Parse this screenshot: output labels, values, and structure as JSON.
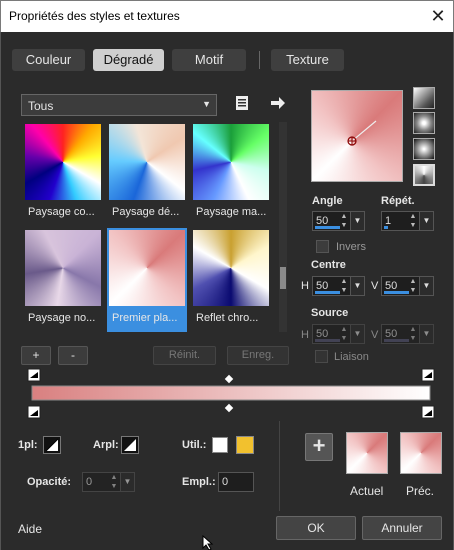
{
  "window": {
    "title": "Propriétés des styles et textures",
    "close": "✕"
  },
  "tabs": [
    {
      "label": "Couleur",
      "selected": false
    },
    {
      "label": "Dégradé",
      "selected": true
    },
    {
      "label": "Motif",
      "selected": false
    },
    {
      "label": "Texture",
      "selected": false
    }
  ],
  "filter": {
    "selected": "Tous"
  },
  "thumbnails": [
    {
      "label": "Paysage co..."
    },
    {
      "label": "Paysage dé..."
    },
    {
      "label": "Paysage ma..."
    },
    {
      "label": "Paysage no..."
    },
    {
      "label": "Premier pla..."
    },
    {
      "label": "Reflet chro..."
    }
  ],
  "list_buttons": {
    "add": "+",
    "remove": "-",
    "reset": "Réinit.",
    "save": "Enreg."
  },
  "angle": {
    "label": "Angle",
    "value": "50"
  },
  "repeat": {
    "label": "Répét.",
    "value": "1"
  },
  "invert": {
    "label": "Invers"
  },
  "center": {
    "label": "Centre",
    "h_label": "H",
    "h": "50",
    "v_label": "V",
    "v": "50"
  },
  "source": {
    "label": "Source",
    "h_label": "H",
    "h": "50",
    "v_label": "V",
    "v": "50"
  },
  "link": {
    "label": "Liaison"
  },
  "lower": {
    "fg_label": "1pl:",
    "bg_label": "Arpl:",
    "user_label": "Util.:",
    "opacity_label": "Opacité:",
    "opacity": "0",
    "location_label": "Empl.:",
    "location": "0",
    "add": "+",
    "current_label": "Actuel",
    "previous_label": "Préc."
  },
  "footer": {
    "help": "Aide",
    "ok": "OK",
    "cancel": "Annuler"
  },
  "colors": {
    "accent": "#3b8fe0",
    "user_color_1": "#ffffff",
    "user_color_2": "#f2c12e",
    "gradient_start": "#d98080",
    "gradient_end": "#ffffff"
  }
}
